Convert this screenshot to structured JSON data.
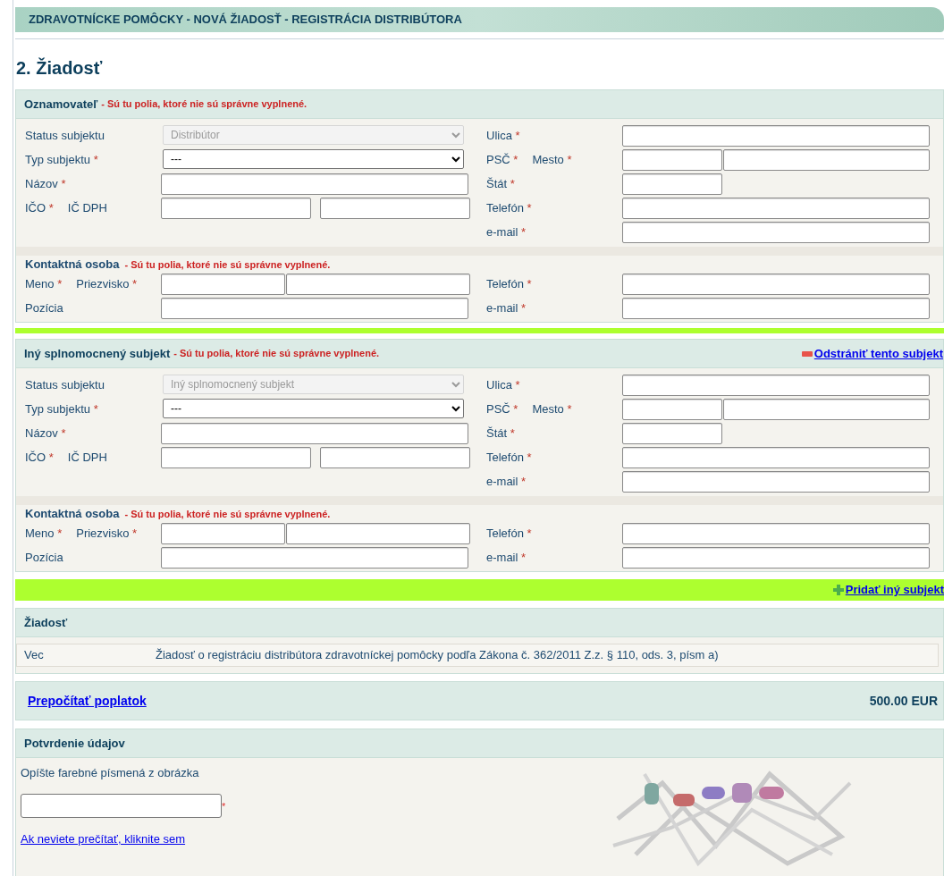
{
  "header": {
    "title": "ZDRAVOTNÍCKE POMÔCKY - NOVÁ ŽIADOSŤ - REGISTRÁCIA DISTRIBÚTORA"
  },
  "heading": "2. Žiadosť",
  "subjects": [
    {
      "title": "Oznamovateľ",
      "error": "- Sú tu polia, ktoré nie sú správne vyplnené.",
      "left": [
        {
          "kind": "select",
          "labels": [
            {
              "text": "Status subjektu"
            }
          ],
          "value": "Distribútor",
          "disabled": true
        },
        {
          "kind": "select",
          "labels": [
            {
              "text": "Typ subjektu",
              "mark": "*"
            }
          ],
          "value": "---",
          "disabled": false
        },
        {
          "kind": "text",
          "labels": [
            {
              "text": "Názov",
              "mark": "*"
            }
          ]
        },
        {
          "kind": "split",
          "labels": [
            {
              "text": "IČO",
              "mark": "*"
            },
            {
              "text": "IČ DPH"
            }
          ]
        }
      ],
      "right": [
        {
          "kind": "text",
          "labels": [
            {
              "text": "Ulica",
              "mark": "*"
            }
          ]
        },
        {
          "kind": "zip_city",
          "labels": [
            {
              "text": "PSČ",
              "mark": "*"
            },
            {
              "text": "Mesto",
              "mark": "*"
            }
          ]
        },
        {
          "kind": "short",
          "labels": [
            {
              "text": "Štát",
              "mark": "*"
            }
          ]
        },
        {
          "kind": "text",
          "labels": [
            {
              "text": "Telefón",
              "mark": "*"
            }
          ]
        },
        {
          "kind": "text",
          "labels": [
            {
              "text": "e-mail",
              "mark": "*"
            }
          ]
        }
      ],
      "contact": {
        "title": "Kontaktná osoba",
        "error": "- Sú tu polia, ktoré nie sú správne vyplnené.",
        "left": [
          {
            "kind": "name_pair",
            "labels": [
              {
                "text": "Meno",
                "mark": "*"
              },
              {
                "text": "Priezvisko",
                "mark": "*"
              }
            ]
          },
          {
            "kind": "text",
            "labels": [
              {
                "text": "Pozícia"
              }
            ]
          }
        ],
        "right": [
          {
            "kind": "text",
            "labels": [
              {
                "text": "Telefón",
                "mark": "*"
              }
            ]
          },
          {
            "kind": "text",
            "labels": [
              {
                "text": "e-mail",
                "mark": "*"
              }
            ]
          }
        ]
      }
    },
    {
      "title": "Iný splnomocnený subjekt",
      "error": "- Sú tu polia, ktoré nie sú správne vyplnené.",
      "remove_link": "Odstrániť tento subjekt",
      "left": [
        {
          "kind": "select",
          "labels": [
            {
              "text": "Status subjektu"
            }
          ],
          "value": "Iný splnomocnený subjekt",
          "disabled": true
        },
        {
          "kind": "select",
          "labels": [
            {
              "text": "Typ subjektu",
              "mark": "*"
            }
          ],
          "value": "---",
          "disabled": false
        },
        {
          "kind": "text",
          "labels": [
            {
              "text": "Názov",
              "mark": "*"
            }
          ]
        },
        {
          "kind": "split",
          "labels": [
            {
              "text": "IČO",
              "mark": "*"
            },
            {
              "text": "IČ DPH"
            }
          ]
        }
      ],
      "right": [
        {
          "kind": "text",
          "labels": [
            {
              "text": "Ulica",
              "mark": "*"
            }
          ]
        },
        {
          "kind": "zip_city",
          "labels": [
            {
              "text": "PSČ",
              "mark": "*"
            },
            {
              "text": "Mesto",
              "mark": "*"
            }
          ]
        },
        {
          "kind": "short",
          "labels": [
            {
              "text": "Štát",
              "mark": "*"
            }
          ]
        },
        {
          "kind": "text",
          "labels": [
            {
              "text": "Telefón",
              "mark": "*"
            }
          ]
        },
        {
          "kind": "text",
          "labels": [
            {
              "text": "e-mail",
              "mark": "*"
            }
          ]
        }
      ],
      "contact": {
        "title": "Kontaktná osoba",
        "error": "- Sú tu polia, ktoré nie sú správne vyplnené.",
        "left": [
          {
            "kind": "name_pair",
            "labels": [
              {
                "text": "Meno",
                "mark": "*"
              },
              {
                "text": "Priezvisko",
                "mark": "*"
              }
            ]
          },
          {
            "kind": "text",
            "labels": [
              {
                "text": "Pozícia"
              }
            ]
          }
        ],
        "right": [
          {
            "kind": "text",
            "labels": [
              {
                "text": "Telefón",
                "mark": "*"
              }
            ]
          },
          {
            "kind": "text",
            "labels": [
              {
                "text": "e-mail",
                "mark": "*"
              }
            ]
          }
        ]
      }
    }
  ],
  "add_link": "Pridať iný subjekt",
  "request": {
    "title": "Žiadosť",
    "rows": [
      {
        "label": "Vec",
        "value": "Žiadosť o registráciu distribútora zdravotníckej pomôcky podľa Zákona č. 362/2011 Z.z. § 110, ods. 3, písm a)"
      }
    ]
  },
  "fee": {
    "link": "Prepočítať poplatok",
    "amount": "500.00 EUR"
  },
  "confirmation": {
    "title": "Potvrdenie údajov",
    "instruction": "Opíšte farebné písmená z obrázka",
    "mark": "*",
    "help_link": "Ak neviete prečítať, kliknite sem"
  }
}
